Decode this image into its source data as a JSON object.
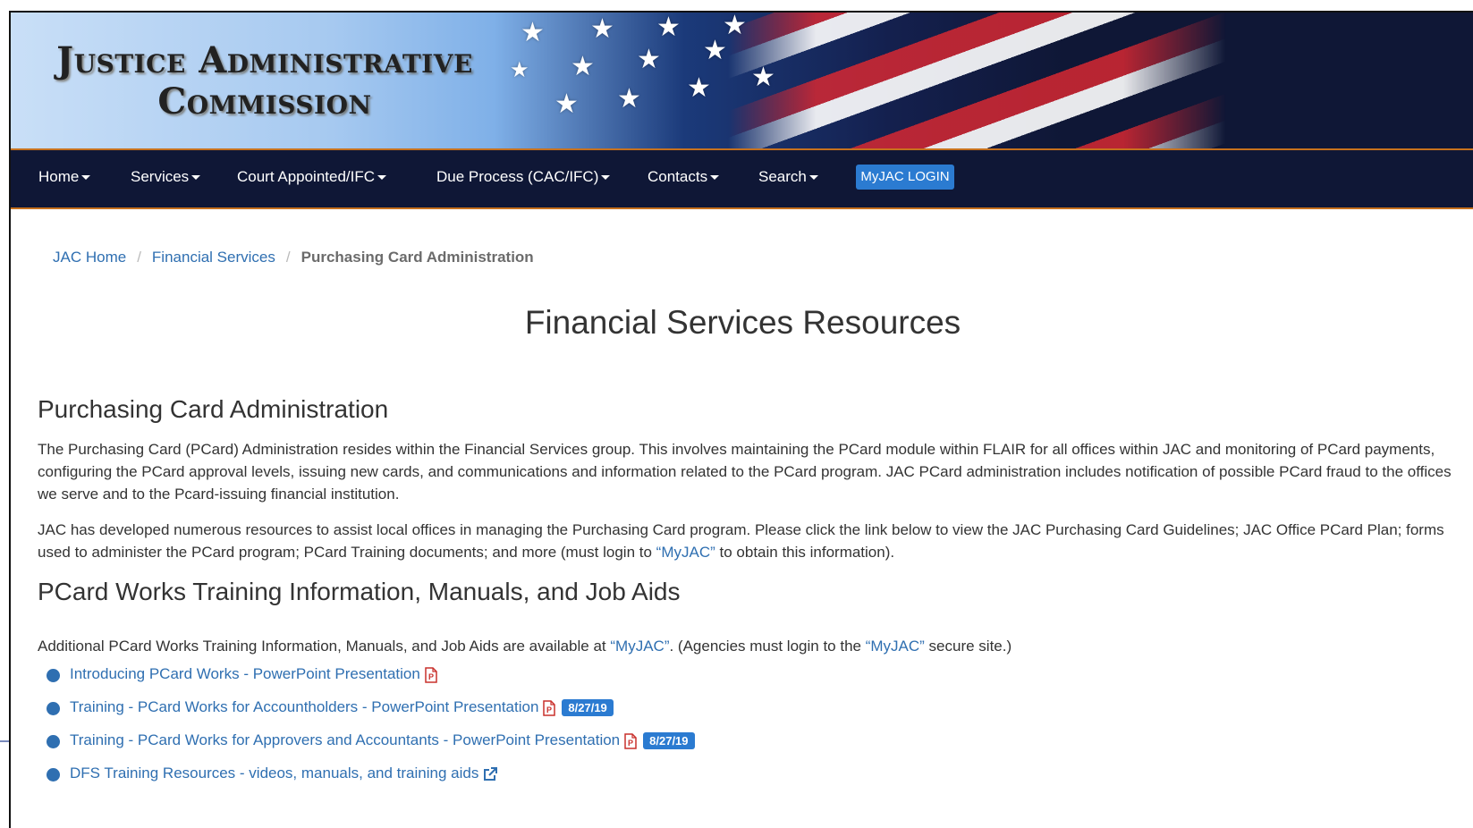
{
  "header": {
    "logo_line1": "Justice Administrative",
    "logo_line2": "Commission"
  },
  "nav": {
    "items": [
      {
        "label": "Home"
      },
      {
        "label": "Services"
      },
      {
        "label": "Court Appointed/IFC"
      },
      {
        "label": "Due Process (CAC/IFC)"
      },
      {
        "label": "Contacts"
      },
      {
        "label": "Search"
      }
    ],
    "login_label": "MyJAC LOGIN"
  },
  "breadcrumb": {
    "home": "JAC Home",
    "section": "Financial Services",
    "current": "Purchasing Card Administration",
    "separator": "/"
  },
  "page_title": "Financial Services Resources",
  "pcard_admin": {
    "heading": "Purchasing Card Administration",
    "para1": "The Purchasing Card (PCard) Administration resides within the Financial Services group. This involves maintaining the PCard module within FLAIR for all offices within JAC and monitoring of PCard payments, configuring the PCard approval levels, issuing new cards, and communications and information related to the PCard program. JAC PCard administration includes notification of possible PCard fraud to the offices we serve and to the Pcard-issuing financial institution.",
    "para2_before": "JAC has developed numerous resources to assist local offices in managing the Purchasing Card program. Please click the link below to view the JAC Purchasing Card Guidelines; JAC Office PCard Plan; forms used to administer the PCard program; PCard Training documents; and more (must login to ",
    "para2_link": "“MyJAC”",
    "para2_after": " to obtain this information)."
  },
  "pcard_works": {
    "heading": "PCard Works Training Information, Manuals, and Job Aids",
    "intro_before": "Additional PCard Works Training Information, Manuals, and Job Aids are available at ",
    "intro_link1": "“MyJAC”",
    "intro_middle": ". (Agencies must login to the ",
    "intro_link2": "“MyJAC”",
    "intro_after": " secure site.)",
    "items": [
      {
        "label": "Introducing PCard Works - PowerPoint Presentation",
        "icon": "pdf-icon",
        "badge": ""
      },
      {
        "label": "Training - PCard Works for Accountholders - PowerPoint Presentation",
        "icon": "pdf-icon",
        "badge": "8/27/19"
      },
      {
        "label": "Training - PCard Works for Approvers and Accountants - PowerPoint Presentation",
        "icon": "pdf-icon",
        "badge": "8/27/19"
      },
      {
        "label": "DFS Training Resources - videos, manuals, and training aids",
        "icon": "external-link-icon",
        "badge": ""
      }
    ]
  },
  "colors": {
    "navbar": "#0f1736",
    "accent": "#c7711d",
    "link": "#2f6fb1",
    "button": "#2b7bd1",
    "pdf_icon": "#c9302c"
  }
}
